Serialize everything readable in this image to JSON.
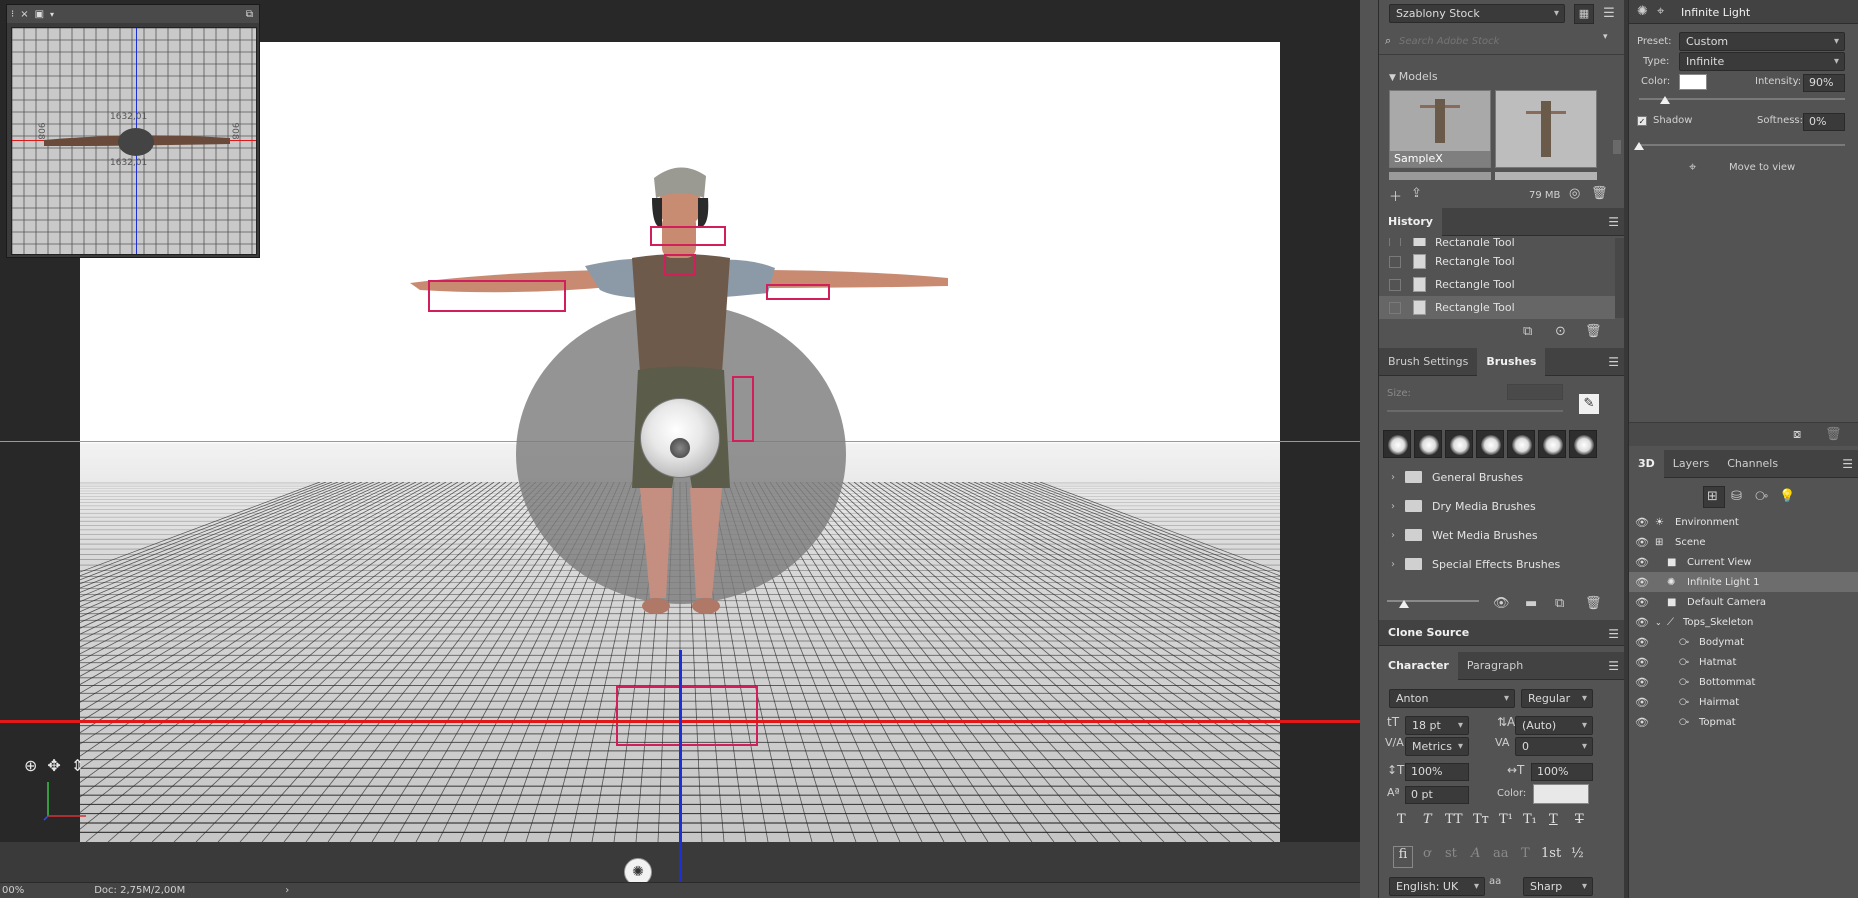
{
  "status": {
    "zoom": "00%",
    "doc": "Doc: 2,75M/2,00M",
    "arrow": "›"
  },
  "mini_view": {
    "close": "×",
    "options": "⁝",
    "camera": "▣",
    "measure_top": "1632,01",
    "measure_bottom": "1632,01",
    "measure_left": "908",
    "measure_right": "908"
  },
  "libraries": {
    "dropdown": "Szablony Stock",
    "search_placeholder": "Search Adobe Stock",
    "section": "Models",
    "thumb1_label": "SampleX",
    "size": "79 MB"
  },
  "history": {
    "tab": "History",
    "items": [
      "Rectangle Tool",
      "Rectangle Tool",
      "Rectangle Tool",
      "Rectangle Tool"
    ]
  },
  "brushes": {
    "tabs": [
      "Brush Settings",
      "Brushes"
    ],
    "size_label": "Size:",
    "folders": [
      "General Brushes",
      "Dry Media Brushes",
      "Wet Media Brushes",
      "Special Effects Brushes"
    ]
  },
  "clone_source": {
    "tab": "Clone Source"
  },
  "character": {
    "tabs": [
      "Character",
      "Paragraph"
    ],
    "font_family": "Anton",
    "font_style": "Regular",
    "font_size": "18 pt",
    "leading": "(Auto)",
    "kerning": "Metrics",
    "tracking": "0",
    "vscale": "100%",
    "hscale": "100%",
    "baseline": "0 pt",
    "color_label": "Color:",
    "language": "English: UK",
    "aa_label": "aa",
    "antialias": "Sharp",
    "style_buttons": [
      "T",
      "T",
      "TT",
      "Tт",
      "T¹",
      "T₁",
      "T",
      "T"
    ],
    "opentype_buttons": [
      "fi",
      "ơ",
      "st",
      "A",
      "aa",
      "T",
      "1st",
      "½"
    ]
  },
  "properties": {
    "title": "Infinite Light",
    "preset_label": "Preset:",
    "preset": "Custom",
    "type_label": "Type:",
    "type": "Infinite",
    "color_label": "Color:",
    "intensity_label": "Intensity:",
    "intensity": "90%",
    "intensity_value": 0.9,
    "shadow_label": "Shadow",
    "softness_label": "Softness:",
    "softness": "0%",
    "move_to_view": "Move to view",
    "light_color": "#ffffff"
  },
  "layers_panel": {
    "tabs": [
      "3D",
      "Layers",
      "Channels"
    ],
    "items": [
      {
        "name": "Environment"
      },
      {
        "name": "Scene"
      },
      {
        "name": "Current View"
      },
      {
        "name": "Infinite Light 1"
      },
      {
        "name": "Default Camera"
      },
      {
        "name": "Tops_Skeleton"
      },
      {
        "name": "Bodymat"
      },
      {
        "name": "Hatmat"
      },
      {
        "name": "Bottommat"
      },
      {
        "name": "Hairmat"
      },
      {
        "name": "Topmat"
      }
    ]
  },
  "colors": {
    "accent_select": "#d01f5a",
    "axis_red": "#e01818",
    "axis_blue": "#1f2fd6"
  }
}
